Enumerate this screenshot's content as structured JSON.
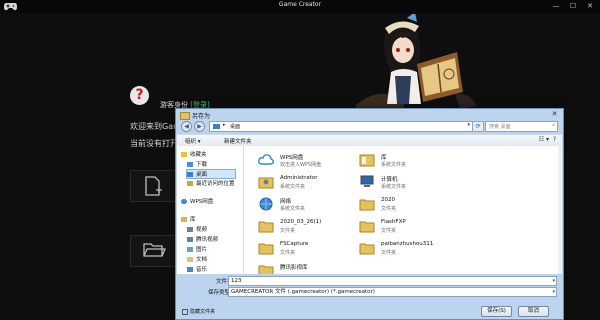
{
  "app": {
    "title": "Game Creator"
  },
  "home": {
    "help_glyph": "?",
    "tourist_text": "游客身份",
    "login_link": "[登录]",
    "welcome": "欢迎来到Game",
    "no_project": "当前没有打开"
  },
  "dialog": {
    "title": "另存为",
    "breadcrumb": "桌面",
    "breadcrumb_arrow": "▸",
    "search_placeholder": "搜索 桌面",
    "toolbar": {
      "organize": "组织 ▾",
      "new_folder": "新建文件夹"
    },
    "sidebar": {
      "items": [
        {
          "label": "收藏夹",
          "icon": "star-icon"
        },
        {
          "label": "下载",
          "icon": "download-folder-icon"
        },
        {
          "label": "桌面",
          "icon": "desktop-icon"
        },
        {
          "label": "最近访问的位置",
          "icon": "recent-places-icon"
        },
        {
          "label": "WPS网盘",
          "icon": "cloud-icon"
        },
        {
          "label": "库",
          "icon": "library-icon"
        },
        {
          "label": "视频",
          "icon": "video-icon"
        },
        {
          "label": "腾讯视频",
          "icon": "video-icon"
        },
        {
          "label": "图片",
          "icon": "picture-icon"
        },
        {
          "label": "文档",
          "icon": "document-icon"
        },
        {
          "label": "音乐",
          "icon": "music-icon"
        }
      ]
    },
    "files": [
      {
        "name": "WPS网盘",
        "desc": "双击进入WPS网盘",
        "icon": "cloud-icon"
      },
      {
        "name": "库",
        "desc": "系统文件夹",
        "icon": "library-icon"
      },
      {
        "name": "Administrator",
        "desc": "系统文件夹",
        "icon": "user-folder-icon"
      },
      {
        "name": "计算机",
        "desc": "系统文件夹",
        "icon": "computer-icon"
      },
      {
        "name": "网络",
        "desc": "系统文件夹",
        "icon": "network-icon"
      },
      {
        "name": "2020",
        "desc": "文件夹",
        "icon": "folder-icon"
      },
      {
        "name": "2020_03_26(1)",
        "desc": "文件夹",
        "icon": "folder-icon"
      },
      {
        "name": "FlashFXP",
        "desc": "文件夹",
        "icon": "folder-icon"
      },
      {
        "name": "FSCapture",
        "desc": "文件夹",
        "icon": "folder-icon"
      },
      {
        "name": "paibanzhushou311",
        "desc": "文件夹",
        "icon": "folder-icon"
      },
      {
        "name": "腾讯影视库",
        "desc": "",
        "icon": "folder-icon"
      }
    ],
    "filename_label": "文件名(N):",
    "filename_value": "123",
    "filetype_label": "保存类型(T):",
    "filetype_value": "GAMECREATOR 文件 (.gamecreator) (*.gamecreator)",
    "hide_folders": "隐藏文件夹",
    "save_button": "保存(S)",
    "cancel_button": "取消"
  },
  "colors": {
    "login": "#2fd46a",
    "dialog_frame": "#bcd4ee",
    "folder": "#e7c25a"
  }
}
